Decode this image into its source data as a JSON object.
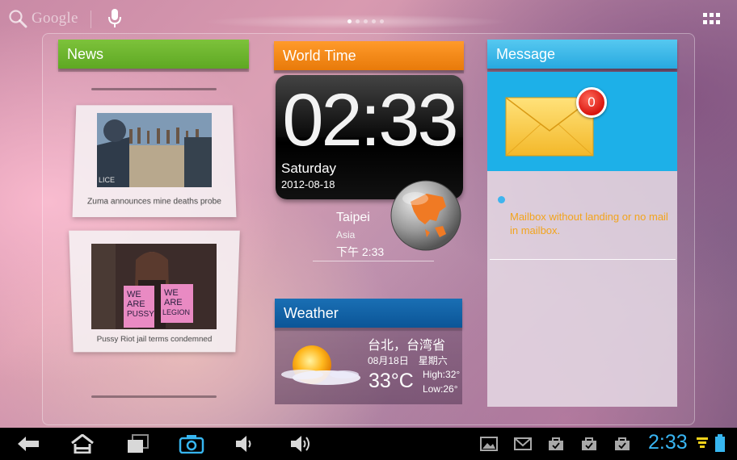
{
  "topbar": {
    "search_label": "Google",
    "page_count": 5,
    "active_page": 0
  },
  "news": {
    "title": "News",
    "items": [
      {
        "caption": "Zuma announces mine deaths probe"
      },
      {
        "caption": "Pussy Riot jail terms condemned"
      }
    ]
  },
  "world_time": {
    "title": "World Time",
    "time": "02:33",
    "day": "Saturday",
    "date": "2012-08-18",
    "city": "Taipei",
    "region": "Asia",
    "local_time": "下午 2:33"
  },
  "weather": {
    "title": "Weather",
    "city": "台北，台湾省",
    "date": "08月18日　星期六",
    "temperature": "33°C",
    "high": "High:32°",
    "low": "Low:26°"
  },
  "message": {
    "title": "Message",
    "unread_count": "0",
    "status_text": "Mailbox without landing or no mail in mailbox."
  },
  "system_bar": {
    "clock": "2:33"
  },
  "colors": {
    "news_header": "#6bb52d",
    "world_time_header": "#f08a14",
    "weather_header": "#1263a8",
    "message_header": "#3bb8ea",
    "message_text": "#f2a41c",
    "clock_blue": "#38b5f2"
  },
  "icons": {
    "search": "search-icon",
    "mic": "mic-icon",
    "apps": "apps-grid-icon",
    "mail": "envelope-icon",
    "globe": "globe-icon",
    "weather": "sun-cloud-icon",
    "back": "back-arrow-icon",
    "home": "home-icon",
    "recents": "recent-apps-icon",
    "screenshot": "camera-icon",
    "volume_down": "volume-down-icon",
    "volume_up": "volume-up-icon",
    "gallery": "gallery-icon",
    "gmail": "gmail-icon",
    "market": "shopping-bag-icon",
    "wifi": "wifi-icon",
    "battery": "battery-icon"
  }
}
